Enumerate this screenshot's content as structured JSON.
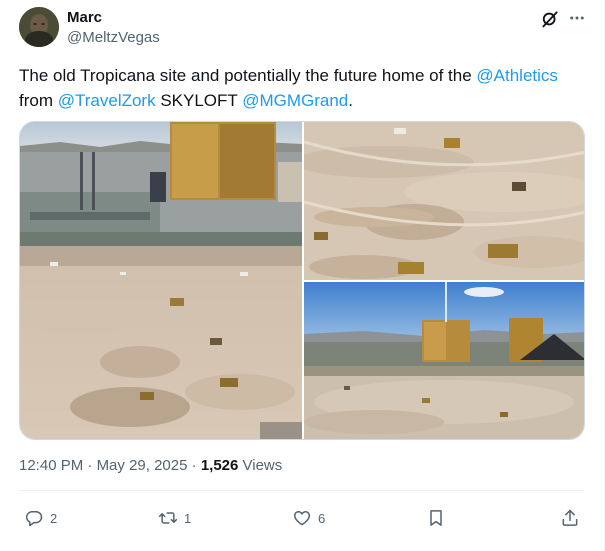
{
  "author": {
    "name": "Marc",
    "handle": "@MeltzVegas"
  },
  "tweet": {
    "text_part1": "The old Tropicana site and potentially the future home of the ",
    "mention_1": "@Athletics",
    "text_part2": " from ",
    "mention_2": "@TravelZork",
    "text_part3": " SKYLOFT ",
    "mention_3": "@MGMGrand",
    "text_part4": "."
  },
  "meta": {
    "time": "12:40 PM",
    "separator_1": " · ",
    "date": "May 29, 2025",
    "separator_2": " · ",
    "views_count": "1,526",
    "views_label": " Views"
  },
  "actions": {
    "replies": "2",
    "reposts": "1",
    "likes": "6"
  },
  "icons": {
    "grok": "grok-icon",
    "more": "more-horizontal-icon",
    "reply": "reply-icon",
    "repost": "repost-icon",
    "like": "heart-icon",
    "bookmark": "bookmark-icon",
    "share": "share-icon"
  },
  "colors": {
    "accent": "#1d9bf0",
    "text": "#0f1419",
    "secondary": "#536471"
  }
}
